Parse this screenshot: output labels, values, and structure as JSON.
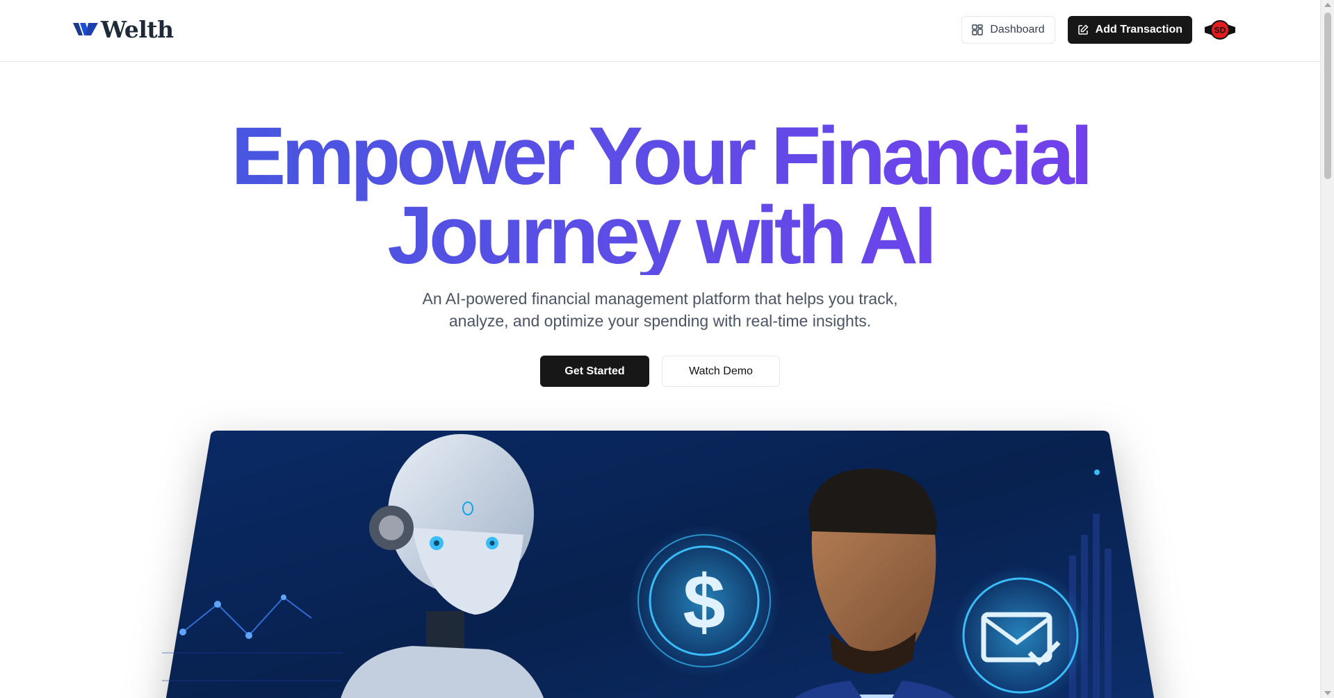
{
  "header": {
    "logo_text": "Welth",
    "dashboard_label": "Dashboard",
    "add_transaction_label": "Add Transaction",
    "avatar_initials": "SD"
  },
  "hero": {
    "title_line1": "Empower Your Financial",
    "title_line2": "Journey with AI",
    "subtitle_line1": "An AI-powered financial management platform that helps you track,",
    "subtitle_line2": "analyze, and optimize your spending with real-time insights.",
    "get_started_label": "Get Started",
    "watch_demo_label": "Watch Demo"
  },
  "icons": {
    "logo": "welth-logo-icon",
    "dashboard": "layout-dashboard-icon",
    "add_transaction": "pen-square-icon",
    "avatar": "user-avatar",
    "hero_dollar": "dollar-icon",
    "hero_mail": "mail-check-icon"
  },
  "colors": {
    "accent_blue": "#3b5bdb",
    "accent_purple": "#7c3aed",
    "primary_button": "#171717",
    "hero_bg": "#0b2a5c"
  }
}
